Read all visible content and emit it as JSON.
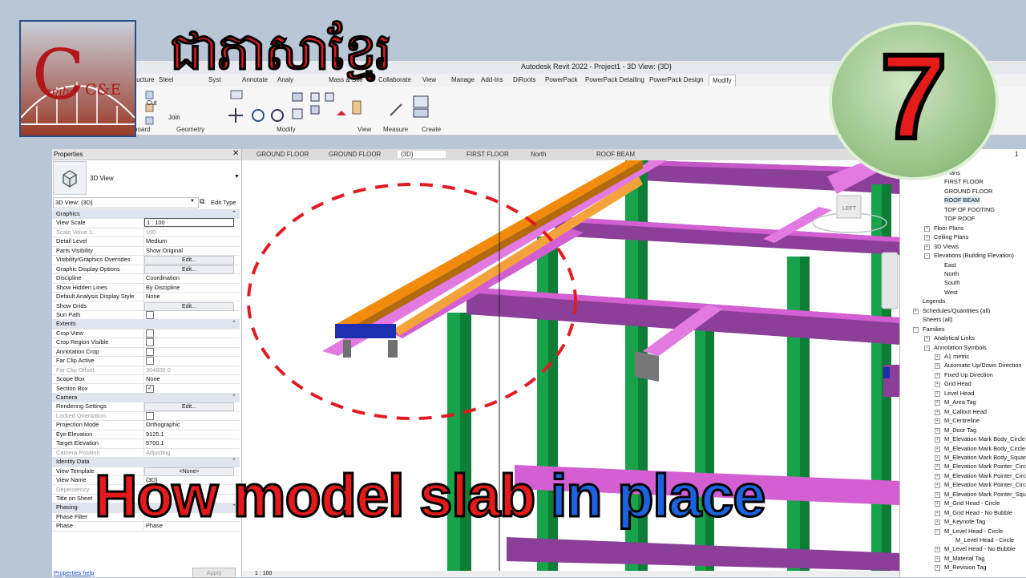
{
  "app": {
    "window_title": "Autodesk Revit 2022 - Project1 - 3D View: {3D}",
    "ribbon_tabs": [
      "Structure",
      "Steel",
      "Syst",
      "Annotate",
      "Analy",
      "Mass & Site",
      "Collaborate",
      "View",
      "Manage",
      "Add-Ins",
      "DiRoots",
      "PowerPack",
      "PowerPack Detailing",
      "PowerPack Design",
      "Modify"
    ],
    "ribbon_active": "Modify",
    "ribbon_panels": {
      "clipboard": "board",
      "geometry": "Geometry",
      "modify": "Modify",
      "view": "View",
      "measure": "Measure",
      "create": "Create"
    },
    "ribbon_small": {
      "cut": "Cut",
      "join": "Join"
    }
  },
  "overlay": {
    "logo_letter": "C",
    "logo_left": "ambo",
    "logo_right": "C&E",
    "khmer_title": "ជាភាសាខ្មែរ",
    "episode_number": "7",
    "headline_red": "How model slab ",
    "headline_blue": "in place"
  },
  "properties": {
    "panel_title": "Properties",
    "type_name": "3D View",
    "instance_selector": "3D View: {3D}",
    "edit_type": "Edit Type",
    "rows": [
      {
        "k": "Graphics",
        "section": true
      },
      {
        "k": "View Scale",
        "v": "1 : 100",
        "input": true
      },
      {
        "k": "Scale Value    1:",
        "v": "100",
        "dim": true
      },
      {
        "k": "Detail Level",
        "v": "Medium"
      },
      {
        "k": "Parts Visibility",
        "v": "Show Original"
      },
      {
        "k": "Visibility/Graphics Overrides",
        "btn": "Edit..."
      },
      {
        "k": "Graphic Display Options",
        "btn": "Edit..."
      },
      {
        "k": "Discipline",
        "v": "Coordination"
      },
      {
        "k": "Show Hidden Lines",
        "v": "By Discipline"
      },
      {
        "k": "Default Analysis Display Style",
        "v": "None"
      },
      {
        "k": "Show Grids",
        "btn": "Edit..."
      },
      {
        "k": "Sun Path",
        "check": false
      },
      {
        "k": "Extents",
        "section": true
      },
      {
        "k": "Crop View",
        "check": false
      },
      {
        "k": "Crop Region Visible",
        "check": false
      },
      {
        "k": "Annotation Crop",
        "check": false
      },
      {
        "k": "Far Clip Active",
        "check": false
      },
      {
        "k": "Far Clip Offset",
        "v": "304800.0",
        "dim": true
      },
      {
        "k": "Scope Box",
        "v": "None"
      },
      {
        "k": "Section Box",
        "check": true
      },
      {
        "k": "Camera",
        "section": true
      },
      {
        "k": "Rendering Settings",
        "btn": "Edit..."
      },
      {
        "k": "Locked Orientation",
        "check": false,
        "dim": true
      },
      {
        "k": "Projection Mode",
        "v": "Orthographic"
      },
      {
        "k": "Eye Elevation",
        "v": "9125.1"
      },
      {
        "k": "Target Elevation",
        "v": "5700.1"
      },
      {
        "k": "Camera Position",
        "v": "Adjusting",
        "dim": true
      },
      {
        "k": "Identity Data",
        "section": true
      },
      {
        "k": "View Template",
        "btn": "<None>"
      },
      {
        "k": "View Name",
        "v": "{3D}"
      },
      {
        "k": "Dependency",
        "v": "Indepe",
        "dim": true
      },
      {
        "k": "Title on Sheet",
        "v": ""
      },
      {
        "k": "Phasing",
        "section": true
      },
      {
        "k": "Phase Filter",
        "v": ""
      },
      {
        "k": "Phase",
        "v": "Phase"
      }
    ],
    "help_link": "Properties help",
    "apply": "Apply"
  },
  "view_tabs": [
    "GROUND FLOOR",
    "GROUND FLOOR",
    "{3D}",
    "FIRST FLOOR",
    "North",
    "ROOF BEAM"
  ],
  "active_view_tab": "{3D}",
  "status": {
    "scale": "1 : 100"
  },
  "viewcube": {
    "face": "LEFT"
  },
  "browser": {
    "header_suffix": "1",
    "items": [
      {
        "t": "ural Plans",
        "lvl": 2
      },
      {
        "t": "FIRST FLOOR",
        "lvl": 3
      },
      {
        "t": "GROUND FLOOR",
        "lvl": 3
      },
      {
        "t": "ROOF BEAM",
        "lvl": 3,
        "sel": true
      },
      {
        "t": "TOP OF FOOTING",
        "lvl": 3
      },
      {
        "t": "TOP ROOF",
        "lvl": 3
      },
      {
        "t": "Floor Plans",
        "lvl": 2,
        "exp": "+"
      },
      {
        "t": "Ceiling Plans",
        "lvl": 2,
        "exp": "+"
      },
      {
        "t": "3D Views",
        "lvl": 2,
        "exp": "+"
      },
      {
        "t": "Elevations (Building Elevation)",
        "lvl": 2,
        "exp": "−"
      },
      {
        "t": "East",
        "lvl": 3
      },
      {
        "t": "North",
        "lvl": 3
      },
      {
        "t": "South",
        "lvl": 3
      },
      {
        "t": "West",
        "lvl": 3
      },
      {
        "t": "Legends",
        "lvl": 1
      },
      {
        "t": "Schedules/Quantities (all)",
        "lvl": 1,
        "exp": "+"
      },
      {
        "t": "Sheets (all)",
        "lvl": 1
      },
      {
        "t": "Families",
        "lvl": 1,
        "exp": "−"
      },
      {
        "t": "Analytical Links",
        "lvl": 2,
        "exp": "+"
      },
      {
        "t": "Annotation Symbols",
        "lvl": 2,
        "exp": "−"
      },
      {
        "t": "A1 metric",
        "lvl": 3,
        "exp": "+"
      },
      {
        "t": "Automatic Up/Down Direction",
        "lvl": 3,
        "exp": "+"
      },
      {
        "t": "Fixed Up Direction",
        "lvl": 3,
        "exp": "+"
      },
      {
        "t": "Grid Head",
        "lvl": 3,
        "exp": "+"
      },
      {
        "t": "Level Head",
        "lvl": 3,
        "exp": "+"
      },
      {
        "t": "M_Area Tag",
        "lvl": 3,
        "exp": "+"
      },
      {
        "t": "M_Callout Head",
        "lvl": 3,
        "exp": "+"
      },
      {
        "t": "M_Centreline",
        "lvl": 3,
        "exp": "+"
      },
      {
        "t": "M_Door Tag",
        "lvl": 3,
        "exp": "+"
      },
      {
        "t": "M_Elevation Mark Body_Circle",
        "lvl": 3,
        "exp": "+"
      },
      {
        "t": "M_Elevation Mark Body_Circle",
        "lvl": 3,
        "exp": "+"
      },
      {
        "t": "M_Elevation Mark Body_Squar",
        "lvl": 3,
        "exp": "+"
      },
      {
        "t": "M_Elevation Mark Pointer_Circ",
        "lvl": 3,
        "exp": "+"
      },
      {
        "t": "M_Elevation Mark Pointer_Circ",
        "lvl": 3,
        "exp": "+"
      },
      {
        "t": "M_Elevation Mark Pointer_Circ",
        "lvl": 3,
        "exp": "+"
      },
      {
        "t": "M_Elevation Mark Pointer_Squ",
        "lvl": 3,
        "exp": "+"
      },
      {
        "t": "M_Grid Head - Circle",
        "lvl": 3,
        "exp": "+"
      },
      {
        "t": "M_Grid Head - No Bubble",
        "lvl": 3,
        "exp": "+"
      },
      {
        "t": "M_Keynote Tag",
        "lvl": 3,
        "exp": "+"
      },
      {
        "t": "M_Level Head - Circle",
        "lvl": 3,
        "exp": "−"
      },
      {
        "t": "M_Level Head - Circle",
        "lvl": 4
      },
      {
        "t": "M_Level Head - No Bubble",
        "lvl": 3,
        "exp": "+"
      },
      {
        "t": "M_Material Tag",
        "lvl": 3,
        "exp": "+"
      },
      {
        "t": "M_Revision Tag",
        "lvl": 3,
        "exp": "+"
      }
    ]
  },
  "colors": {
    "beam": "#d35fd3",
    "beam_dark": "#8b3f98",
    "column": "#17a34a",
    "roof_beam": "#f28b0c",
    "accent_red": "#e51a1a",
    "accent_blue": "#1d63e0"
  }
}
